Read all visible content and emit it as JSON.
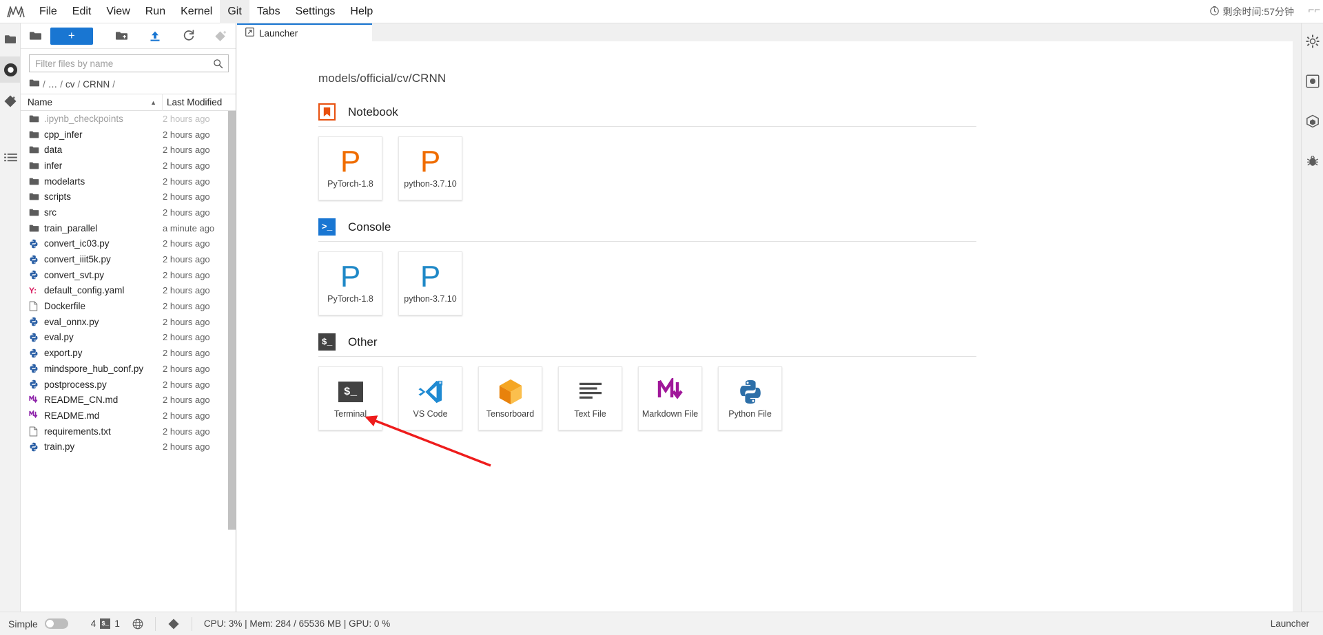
{
  "menu": {
    "logo": "jupyterlab-logo",
    "items": [
      {
        "label": "File"
      },
      {
        "label": "Edit"
      },
      {
        "label": "View"
      },
      {
        "label": "Run"
      },
      {
        "label": "Kernel"
      },
      {
        "label": "Git",
        "active": true
      },
      {
        "label": "Tabs"
      },
      {
        "label": "Settings"
      },
      {
        "label": "Help"
      }
    ],
    "timer": "剩余时间:57分钟"
  },
  "left_rail": {
    "items": [
      {
        "name": "file-browser-icon",
        "selected": false
      },
      {
        "name": "running-terminals-icon",
        "selected": true
      },
      {
        "name": "git-icon",
        "selected": false
      },
      {
        "name": "table-of-contents-icon",
        "selected": false
      }
    ]
  },
  "right_rail": {
    "items": [
      {
        "name": "settings-gear-icon"
      },
      {
        "name": "property-inspector-icon"
      },
      {
        "name": "extensions-icon"
      },
      {
        "name": "debugger-icon"
      }
    ]
  },
  "file_browser": {
    "toolbar": {
      "folder_label": "",
      "new_launcher_label": "+",
      "new_folder_label": "",
      "upload_label": "",
      "refresh_label": "",
      "git_clone_label": ""
    },
    "filter": {
      "placeholder": "Filter files by name",
      "value": ""
    },
    "breadcrumb": [
      "/",
      "…",
      "/",
      "cv",
      "/",
      "CRNN",
      "/"
    ],
    "columns": {
      "name": "Name",
      "last_modified": "Last Modified"
    },
    "sort": "ascending",
    "rows": [
      {
        "name": ".ipynb_checkpoints",
        "modified": "2 hours ago",
        "type": "folder",
        "dim": true
      },
      {
        "name": "cpp_infer",
        "modified": "2 hours ago",
        "type": "folder"
      },
      {
        "name": "data",
        "modified": "2 hours ago",
        "type": "folder"
      },
      {
        "name": "infer",
        "modified": "2 hours ago",
        "type": "folder"
      },
      {
        "name": "modelarts",
        "modified": "2 hours ago",
        "type": "folder"
      },
      {
        "name": "scripts",
        "modified": "2 hours ago",
        "type": "folder"
      },
      {
        "name": "src",
        "modified": "2 hours ago",
        "type": "folder"
      },
      {
        "name": "train_parallel",
        "modified": "a minute ago",
        "type": "folder"
      },
      {
        "name": "convert_ic03.py",
        "modified": "2 hours ago",
        "type": "python"
      },
      {
        "name": "convert_iiit5k.py",
        "modified": "2 hours ago",
        "type": "python"
      },
      {
        "name": "convert_svt.py",
        "modified": "2 hours ago",
        "type": "python"
      },
      {
        "name": "default_config.yaml",
        "modified": "2 hours ago",
        "type": "yaml"
      },
      {
        "name": "Dockerfile",
        "modified": "2 hours ago",
        "type": "file"
      },
      {
        "name": "eval_onnx.py",
        "modified": "2 hours ago",
        "type": "python"
      },
      {
        "name": "eval.py",
        "modified": "2 hours ago",
        "type": "python"
      },
      {
        "name": "export.py",
        "modified": "2 hours ago",
        "type": "python"
      },
      {
        "name": "mindspore_hub_conf.py",
        "modified": "2 hours ago",
        "type": "python"
      },
      {
        "name": "postprocess.py",
        "modified": "2 hours ago",
        "type": "python"
      },
      {
        "name": "README_CN.md",
        "modified": "2 hours ago",
        "type": "markdown"
      },
      {
        "name": "README.md",
        "modified": "2 hours ago",
        "type": "markdown"
      },
      {
        "name": "requirements.txt",
        "modified": "2 hours ago",
        "type": "file"
      },
      {
        "name": "train.py",
        "modified": "2 hours ago",
        "type": "python"
      }
    ]
  },
  "main": {
    "tabs": [
      {
        "label": "Launcher",
        "icon": "launcher-icon",
        "active": true
      }
    ],
    "launcher": {
      "cwd": "models/official/cv/CRNN",
      "sections": [
        {
          "title": "Notebook",
          "icon": "notebook-icon",
          "icon_color": "#e8500e",
          "cards": [
            {
              "label": "PyTorch-1.8",
              "icon": "kernel-letter-P",
              "color": "#ef6c00"
            },
            {
              "label": "python-3.7.10",
              "icon": "kernel-letter-P",
              "color": "#ef6c00"
            }
          ]
        },
        {
          "title": "Console",
          "icon": "console-icon",
          "icon_color": "#1976d2",
          "icon_text": ">_",
          "cards": [
            {
              "label": "PyTorch-1.8",
              "icon": "kernel-letter-P",
              "color": "#1e88c7"
            },
            {
              "label": "python-3.7.10",
              "icon": "kernel-letter-P",
              "color": "#1e88c7"
            }
          ]
        },
        {
          "title": "Other",
          "icon": "terminal-icon",
          "icon_color": "#424242",
          "icon_text": "$_",
          "cards": [
            {
              "label": "Terminal",
              "icon": "terminal-icon"
            },
            {
              "label": "VS Code",
              "icon": "vscode-icon"
            },
            {
              "label": "Tensorboard",
              "icon": "tensorboard-icon"
            },
            {
              "label": "Text File",
              "icon": "text-file-icon"
            },
            {
              "label": "Markdown File",
              "icon": "markdown-file-icon"
            },
            {
              "label": "Python File",
              "icon": "python-file-icon"
            }
          ]
        }
      ]
    }
  },
  "annotation": {
    "arrow_color": "#ee1c1c",
    "points_to": "Terminal"
  },
  "statusbar": {
    "mode_label": "Simple",
    "mode_on": false,
    "kernel_count": "4",
    "terminal_count": "1",
    "terminal_badge": "$_",
    "globe_icon": "globe-icon",
    "git_icon": "git-icon",
    "resources": "CPU: 3% | Mem: 284 / 65536 MB | GPU: 0 %",
    "right_label": "Launcher"
  }
}
